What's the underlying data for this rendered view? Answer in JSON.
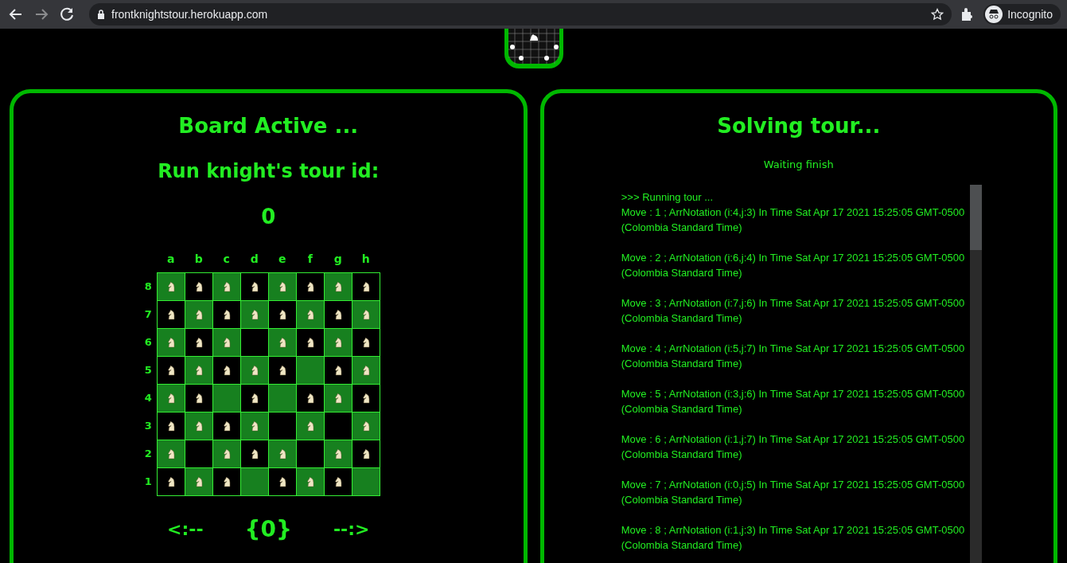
{
  "browser": {
    "url": "frontknightstour.herokuapp.com",
    "profile": "Incognito"
  },
  "board_panel": {
    "title": "Board Active ...",
    "subtitle": "Run knight's tour id:",
    "tour_id": "0",
    "files": [
      "a",
      "b",
      "c",
      "d",
      "e",
      "f",
      "g",
      "h"
    ],
    "ranks": [
      {
        "label": "8",
        "cells": [
          {
            "knight": true
          },
          {
            "knight": true
          },
          {
            "knight": true
          },
          {
            "knight": true
          },
          {
            "knight": true
          },
          {
            "knight": true
          },
          {
            "knight": true
          },
          {
            "knight": true
          }
        ]
      },
      {
        "label": "7",
        "cells": [
          {
            "knight": true
          },
          {
            "knight": true
          },
          {
            "knight": true
          },
          {
            "knight": true
          },
          {
            "knight": true
          },
          {
            "knight": true
          },
          {
            "knight": true
          },
          {
            "knight": true
          }
        ]
      },
      {
        "label": "6",
        "cells": [
          {
            "knight": true
          },
          {
            "knight": true
          },
          {
            "knight": true
          },
          {
            "knight": false
          },
          {
            "knight": true
          },
          {
            "knight": true
          },
          {
            "knight": true
          },
          {
            "knight": true
          }
        ]
      },
      {
        "label": "5",
        "cells": [
          {
            "knight": true
          },
          {
            "knight": true
          },
          {
            "knight": true
          },
          {
            "knight": true
          },
          {
            "knight": true
          },
          {
            "knight": false
          },
          {
            "knight": true
          },
          {
            "knight": true
          }
        ]
      },
      {
        "label": "4",
        "cells": [
          {
            "knight": true
          },
          {
            "knight": true
          },
          {
            "knight": false
          },
          {
            "knight": true
          },
          {
            "knight": false
          },
          {
            "knight": true
          },
          {
            "knight": true
          },
          {
            "knight": true
          }
        ]
      },
      {
        "label": "3",
        "cells": [
          {
            "knight": true
          },
          {
            "knight": true
          },
          {
            "knight": true
          },
          {
            "knight": true
          },
          {
            "knight": false
          },
          {
            "knight": true
          },
          {
            "knight": false
          },
          {
            "knight": true
          }
        ]
      },
      {
        "label": "2",
        "cells": [
          {
            "knight": true
          },
          {
            "knight": false
          },
          {
            "knight": true
          },
          {
            "knight": true
          },
          {
            "knight": true
          },
          {
            "knight": false
          },
          {
            "knight": true
          },
          {
            "knight": true
          }
        ]
      },
      {
        "label": "1",
        "cells": [
          {
            "knight": true
          },
          {
            "knight": true
          },
          {
            "knight": true
          },
          {
            "knight": false
          },
          {
            "knight": true
          },
          {
            "knight": true
          },
          {
            "knight": true
          },
          {
            "knight": false
          }
        ]
      }
    ],
    "nav": {
      "previous": "<:--",
      "current": "{0}",
      "next": "--:>"
    }
  },
  "solver_panel": {
    "title": "Solving tour...",
    "status": "Waiting finish",
    "log": [
      {
        "kind": "header",
        "text": ">>> Running tour ..."
      },
      {
        "kind": "move",
        "text": "Move : 1 ; ArrNotation (i:4,j:3) In Time Sat Apr 17 2021 15:25:05 GMT-0500 (Colombia Standard Time)"
      },
      {
        "kind": "move",
        "text": "Move : 2 ; ArrNotation (i:6,j:4) In Time Sat Apr 17 2021 15:25:05 GMT-0500 (Colombia Standard Time)"
      },
      {
        "kind": "move",
        "text": "Move : 3 ; ArrNotation (i:7,j:6) In Time Sat Apr 17 2021 15:25:05 GMT-0500 (Colombia Standard Time)"
      },
      {
        "kind": "move",
        "text": "Move : 4 ; ArrNotation (i:5,j:7) In Time Sat Apr 17 2021 15:25:05 GMT-0500 (Colombia Standard Time)"
      },
      {
        "kind": "move",
        "text": "Move : 5 ; ArrNotation (i:3,j:6) In Time Sat Apr 17 2021 15:25:05 GMT-0500 (Colombia Standard Time)"
      },
      {
        "kind": "move",
        "text": "Move : 6 ; ArrNotation (i:1,j:7) In Time Sat Apr 17 2021 15:25:05 GMT-0500 (Colombia Standard Time)"
      },
      {
        "kind": "move",
        "text": "Move : 7 ; ArrNotation (i:0,j:5) In Time Sat Apr 17 2021 15:25:05 GMT-0500 (Colombia Standard Time)"
      },
      {
        "kind": "move",
        "text": "Move : 8 ; ArrNotation (i:1,j:3) In Time Sat Apr 17 2021 15:25:05 GMT-0500 (Colombia Standard Time)"
      }
    ]
  }
}
